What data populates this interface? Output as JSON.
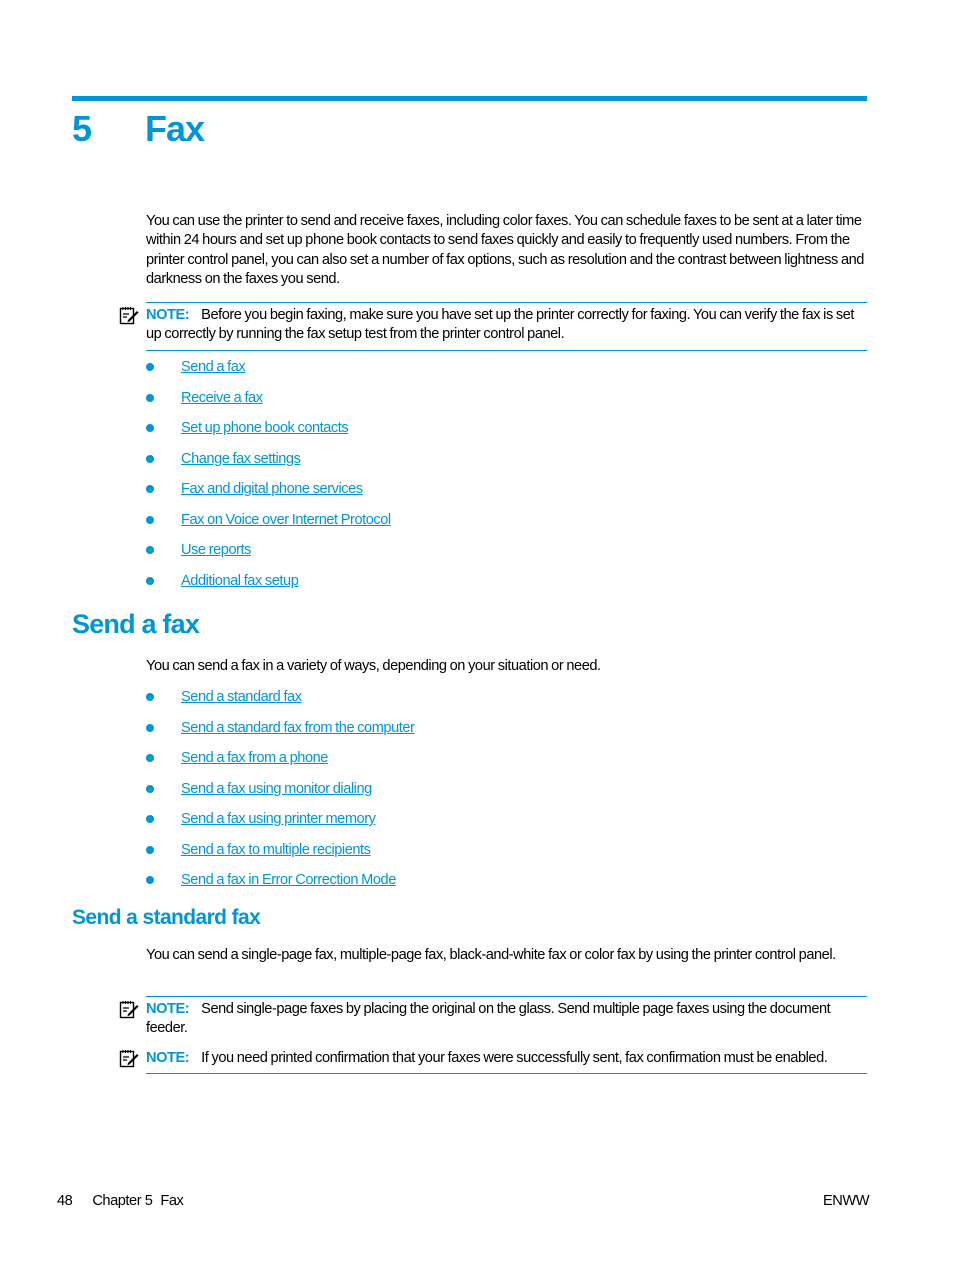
{
  "colors": {
    "accent": "#0096d6",
    "text": "#000000"
  },
  "chapter": {
    "number": "5",
    "title": "Fax"
  },
  "intro": {
    "text": "You can use the printer to send and receive faxes, including color faxes. You can schedule faxes to be sent at a later time within 24 hours and set up phone book contacts to send faxes quickly and easily to frequently used numbers. From the printer control panel, you can also set a number of fax options, such as resolution and the contrast between lightness and darkness on the faxes you send."
  },
  "intro_note": {
    "icon": "note-icon",
    "label": "NOTE:",
    "text": "Before you begin faxing, make sure you have set up the printer correctly for faxing. You can verify the fax is set up correctly by running the fax setup test from the printer control panel."
  },
  "chapter_links": [
    {
      "label": "Send a fax"
    },
    {
      "label": "Receive a fax"
    },
    {
      "label": "Set up phone book contacts"
    },
    {
      "label": "Change fax settings"
    },
    {
      "label": "Fax and digital phone services"
    },
    {
      "label": "Fax on Voice over Internet Protocol"
    },
    {
      "label": "Use reports"
    },
    {
      "label": "Additional fax setup"
    }
  ],
  "send_fax": {
    "heading": "Send a fax",
    "text": "You can send a fax in a variety of ways, depending on your situation or need.",
    "links": [
      {
        "label": "Send a standard fax"
      },
      {
        "label": "Send a standard fax from the computer"
      },
      {
        "label": "Send a fax from a phone"
      },
      {
        "label": "Send a fax using monitor dialing"
      },
      {
        "label": "Send a fax using printer memory"
      },
      {
        "label": "Send a fax to multiple recipients"
      },
      {
        "label": "Send a fax in Error Correction Mode"
      }
    ]
  },
  "standard_fax": {
    "heading": "Send a standard fax",
    "text": "You can send a single-page fax, multiple-page fax, black-and-white fax or color fax by using the printer control panel.",
    "notes": [
      {
        "label": "NOTE:",
        "text": "Send single-page faxes by placing the original on the glass. Send multiple page faxes using the document feeder."
      },
      {
        "label": "NOTE:",
        "text": "If you need printed confirmation that your faxes were successfully sent, fax confirmation must be enabled."
      }
    ]
  },
  "footer": {
    "page_number": "48",
    "chapter_label": "Chapter 5",
    "chapter_title": "Fax",
    "locale": "ENWW"
  }
}
